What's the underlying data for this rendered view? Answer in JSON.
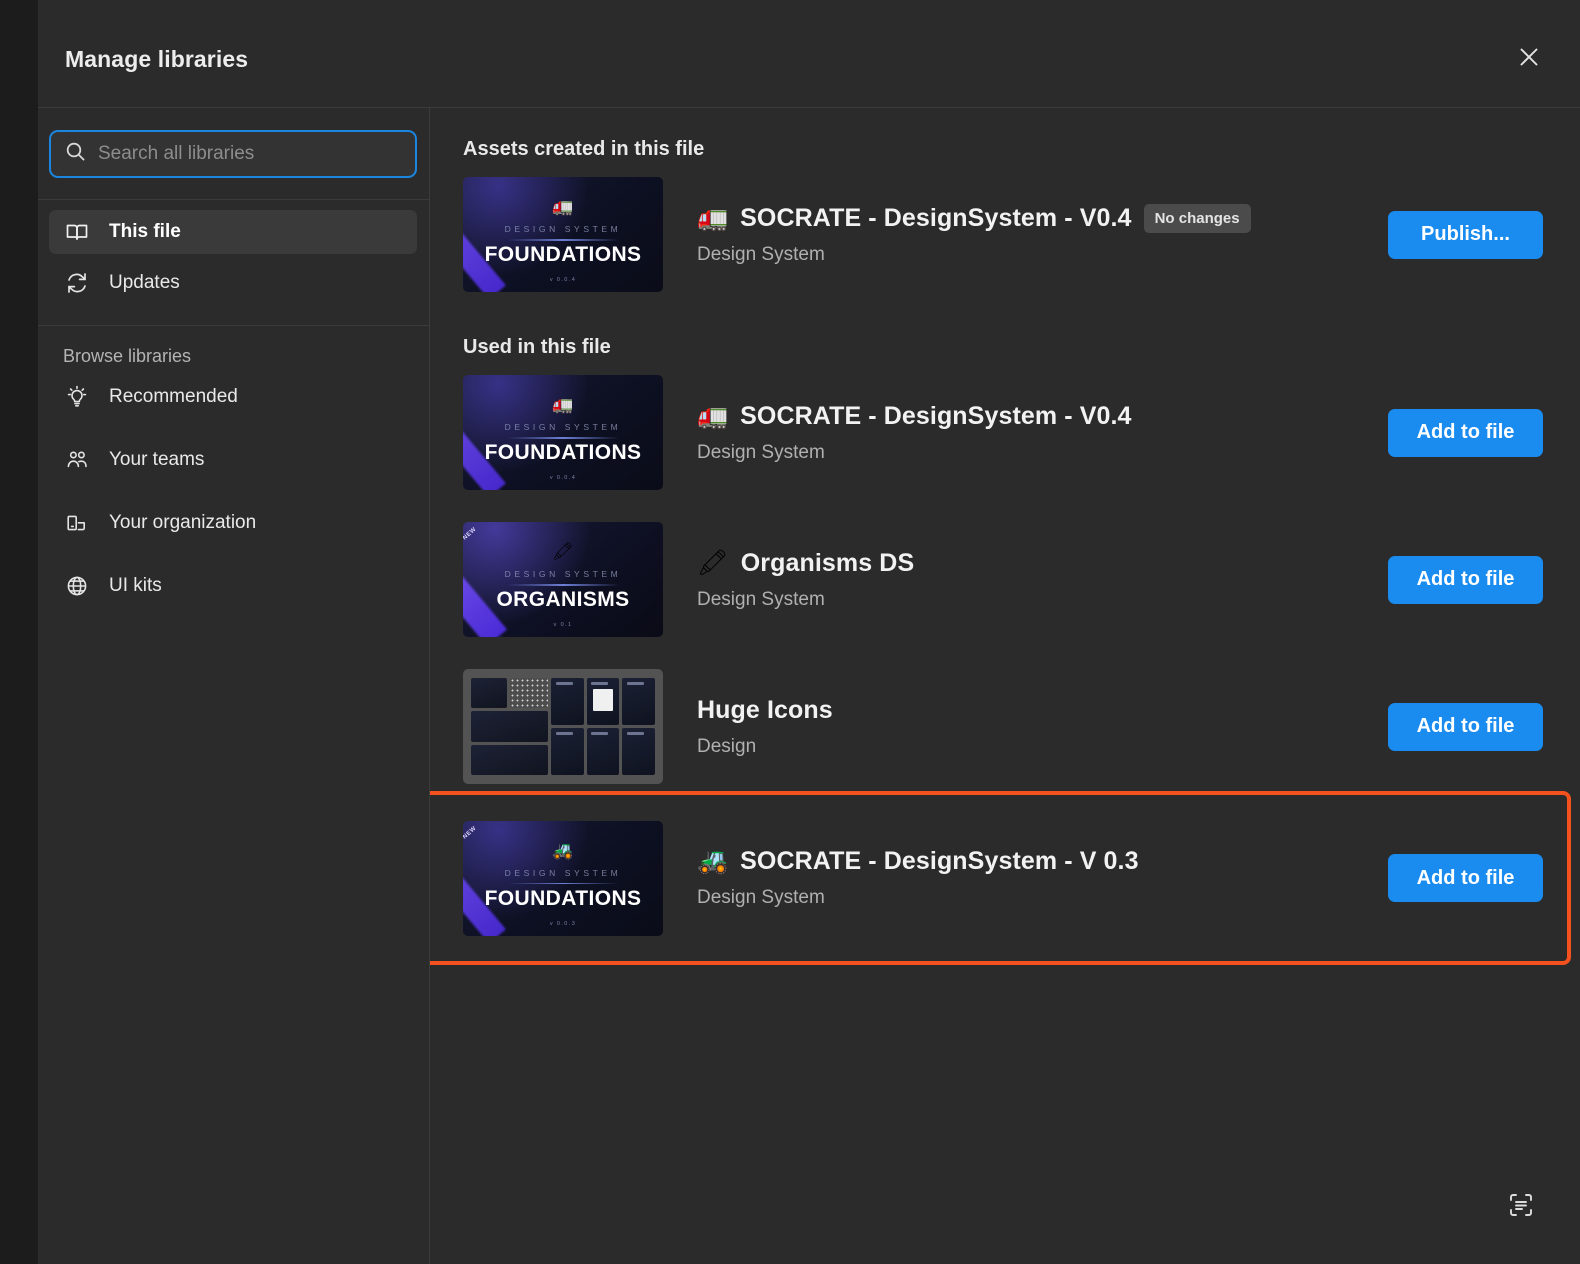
{
  "header": {
    "title": "Manage libraries",
    "close_icon": "close-icon"
  },
  "search": {
    "placeholder": "Search all libraries",
    "value": "",
    "icon": "search-icon"
  },
  "sidebar": {
    "primary_items": [
      {
        "label": "This file",
        "icon": "book-icon",
        "selected": true
      },
      {
        "label": "Updates",
        "icon": "refresh-icon",
        "selected": false
      }
    ],
    "browse_section_title": "Browse libraries",
    "browse_items": [
      {
        "label": "Recommended",
        "icon": "lightbulb-icon"
      },
      {
        "label": "Your teams",
        "icon": "people-icon"
      },
      {
        "label": "Your organization",
        "icon": "building-icon"
      },
      {
        "label": "UI kits",
        "icon": "globe-icon"
      }
    ]
  },
  "main": {
    "sections": [
      {
        "title": "Assets created in this file",
        "rows": [
          {
            "emoji": "🚛",
            "name": "SOCRATE - DesignSystem - V0.4",
            "subtitle": "Design System",
            "badge": "No changes",
            "action_label": "Publish...",
            "thumb": {
              "kind": "foundations",
              "kicker": "DESIGN SYSTEM",
              "title": "FOUNDATIONS",
              "emoji": "🚛",
              "foot": "v 0.0.4",
              "ribbon": ""
            }
          }
        ]
      },
      {
        "title": "Used in this file",
        "rows": [
          {
            "emoji": "🚛",
            "name": "SOCRATE - DesignSystem - V0.4",
            "subtitle": "Design System",
            "badge": "",
            "action_label": "Add to file",
            "thumb": {
              "kind": "foundations",
              "kicker": "DESIGN SYSTEM",
              "title": "FOUNDATIONS",
              "emoji": "🚛",
              "foot": "v 0.0.4",
              "ribbon": ""
            }
          },
          {
            "emoji": "🖍",
            "name": "Organisms DS",
            "subtitle": "Design System",
            "badge": "",
            "action_label": "Add to file",
            "thumb": {
              "kind": "organisms",
              "kicker": "DESIGN SYSTEM",
              "title": "ORGANISMS",
              "emoji": "🖍",
              "foot": "v 0.1",
              "ribbon": "NEW"
            }
          },
          {
            "emoji": "",
            "name": "Huge Icons",
            "subtitle": "Design",
            "badge": "",
            "action_label": "Add to file",
            "thumb": {
              "kind": "hugeicons",
              "kicker": "",
              "title": "",
              "emoji": "",
              "foot": "",
              "ribbon": ""
            }
          },
          {
            "emoji": "🚜",
            "name": "SOCRATE - DesignSystem - V 0.3",
            "subtitle": "Design System",
            "badge": "",
            "action_label": "Add to file",
            "highlighted": true,
            "thumb": {
              "kind": "foundations",
              "kicker": "DESIGN SYSTEM",
              "title": "FOUNDATIONS",
              "emoji": "🚜",
              "foot": "v 0.0.3",
              "ribbon": "NEW"
            }
          }
        ]
      }
    ],
    "scan_icon": "scan-text-icon"
  },
  "colors": {
    "accent_blue": "#1a8cf0",
    "highlight_orange": "#f4511e",
    "panel_bg": "#2b2b2b",
    "badge_bg": "#4b4b4b"
  }
}
